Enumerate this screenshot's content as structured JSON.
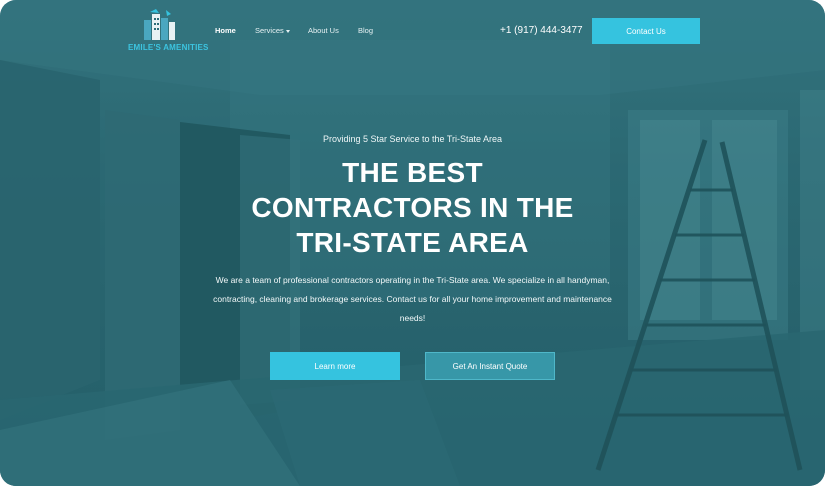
{
  "brand": {
    "logo_text": "EMILE'S AMENITIES",
    "accent_color": "#35c3df"
  },
  "nav": {
    "items": [
      {
        "label": "Home",
        "active": true
      },
      {
        "label": "Services",
        "has_dropdown": true
      },
      {
        "label": "About Us"
      },
      {
        "label": "Blog"
      }
    ],
    "phone": "+1 (917) 444-3477",
    "contact_label": "Contact Us"
  },
  "hero": {
    "kicker": "Providing 5 Star Service to the Tri-State Area",
    "title_lines": [
      "THE BEST",
      "CONTRACTORS IN THE",
      "TRI-STATE AREA"
    ],
    "description": "We are a team of professional contractors operating in the Tri-State area. We specialize in all handyman, contracting, cleaning and brokerage services. Contact us for all your home improvement and maintenance needs!",
    "primary_button": "Learn more",
    "secondary_button": "Get An Instant Quote"
  }
}
